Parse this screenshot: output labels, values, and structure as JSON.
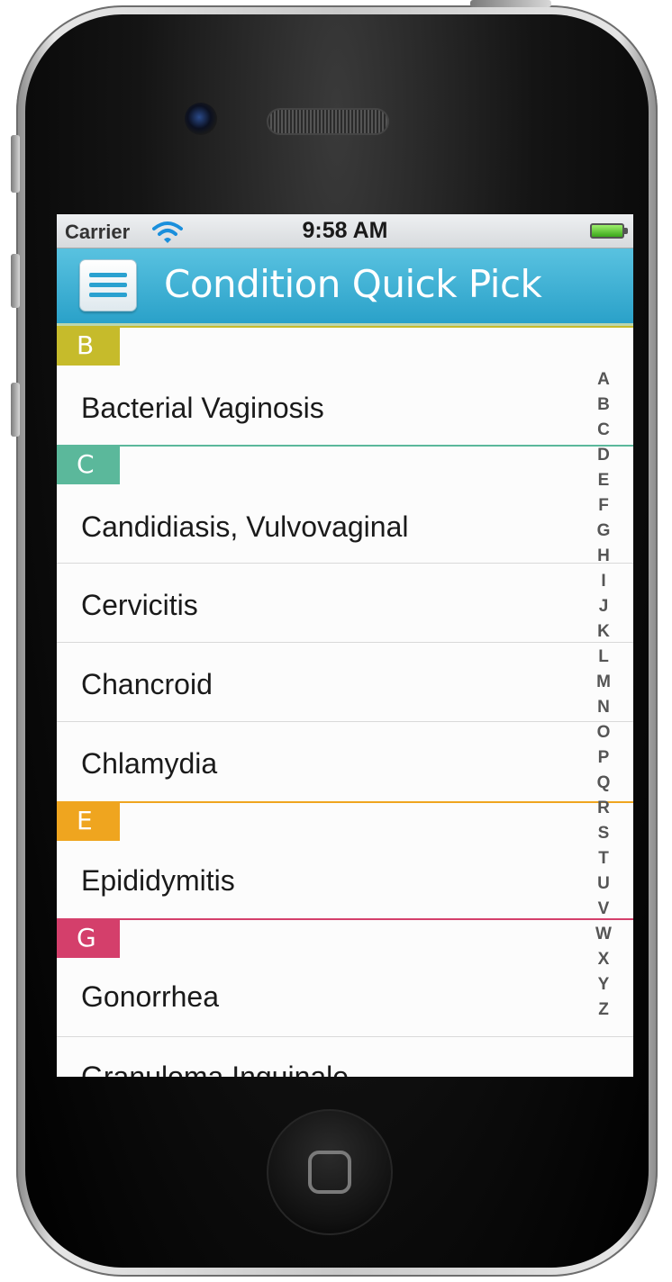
{
  "status_bar": {
    "carrier": "Carrier",
    "time": "9:58 AM"
  },
  "nav": {
    "title": "Condition Quick Pick"
  },
  "sections": [
    {
      "letter": "B",
      "color": "#c6bb2b",
      "items": [
        "Bacterial Vaginosis"
      ]
    },
    {
      "letter": "C",
      "color": "#5bb89b",
      "items": [
        "Candidiasis, Vulvovaginal",
        "Cervicitis",
        "Chancroid",
        "Chlamydia"
      ]
    },
    {
      "letter": "E",
      "color": "#efa51f",
      "items": [
        "Epididymitis"
      ]
    },
    {
      "letter": "G",
      "color": "#d43f6b",
      "items": [
        "Gonorrhea",
        "Granuloma Inguinale"
      ]
    }
  ],
  "index_letters": [
    "A",
    "B",
    "C",
    "D",
    "E",
    "F",
    "G",
    "H",
    "I",
    "J",
    "K",
    "L",
    "M",
    "N",
    "O",
    "P",
    "Q",
    "R",
    "S",
    "T",
    "U",
    "V",
    "W",
    "X",
    "Y",
    "Z"
  ]
}
